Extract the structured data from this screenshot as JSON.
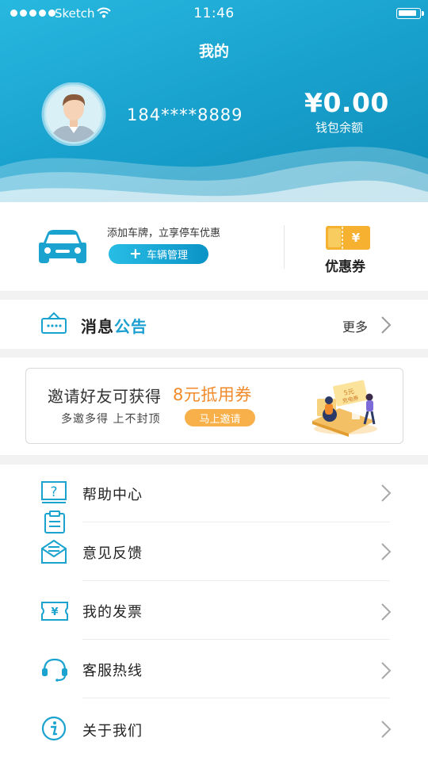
{
  "status_bar": {
    "carrier": "Sketch",
    "time": "11:46"
  },
  "header": {
    "title": "我的",
    "phone": "184****8889",
    "balance": "¥0.00",
    "balance_label": "钱包余额"
  },
  "vehicle": {
    "hint": "添加车牌，立享停车优惠",
    "button_label": "车辆管理"
  },
  "coupon": {
    "label": "优惠券"
  },
  "notice": {
    "title_part1": "消息",
    "title_part2": "公告",
    "more_label": "更多"
  },
  "invite": {
    "title": "邀请好友可获得",
    "highlight": "8元抵用券",
    "subtitle": "多邀多得  上不封顶",
    "button_label": "马上邀请",
    "illustration_text_1": "5元",
    "illustration_text_2": "充电券"
  },
  "menu": {
    "items": [
      {
        "label": "帮助中心",
        "icon": "help-icon"
      },
      {
        "label": "意见反馈",
        "icon": "feedback-icon"
      },
      {
        "label": "我的发票",
        "icon": "invoice-icon"
      },
      {
        "label": "客服热线",
        "icon": "headset-icon"
      },
      {
        "label": "关于我们",
        "icon": "info-icon"
      }
    ]
  },
  "colors": {
    "brand_blue": "#1aa3cf",
    "accent_orange": "#f08a2a",
    "invite_button": "#f7b04a",
    "coupon_gold": "#f5b12f"
  }
}
